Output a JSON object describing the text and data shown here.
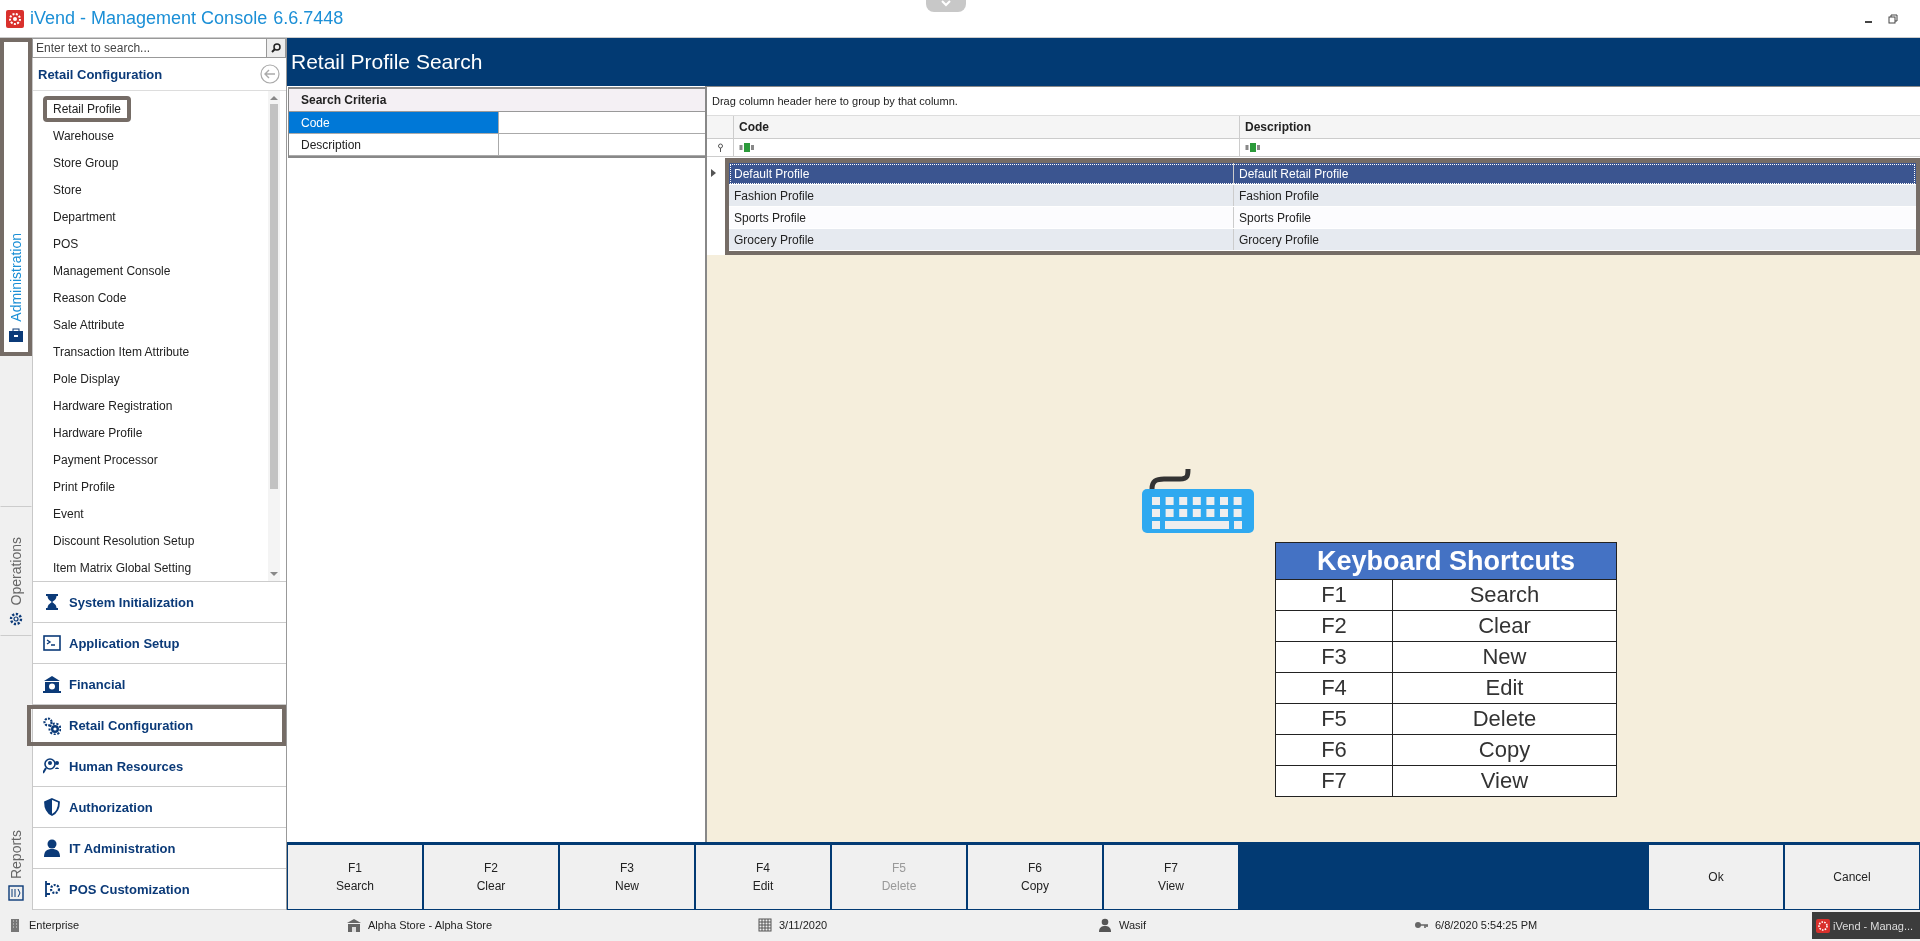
{
  "window": {
    "title": "iVend - Management Console",
    "version": "6.6.7448"
  },
  "side_tabs": [
    {
      "label": "Administration",
      "selected": true
    },
    {
      "label": "Operations",
      "selected": false
    },
    {
      "label": "Reports",
      "selected": false
    }
  ],
  "sidebar": {
    "search": {
      "placeholder": "Enter text to search..."
    },
    "title": "Retail Configuration",
    "items": [
      {
        "label": "Retail Profile",
        "selected": true
      },
      {
        "label": "Warehouse",
        "selected": false
      },
      {
        "label": "Store Group",
        "selected": false
      },
      {
        "label": "Store",
        "selected": false
      },
      {
        "label": "Department",
        "selected": false
      },
      {
        "label": "POS",
        "selected": false
      },
      {
        "label": "Management Console",
        "selected": false
      },
      {
        "label": "Reason Code",
        "selected": false
      },
      {
        "label": "Sale Attribute",
        "selected": false
      },
      {
        "label": "Transaction Item Attribute",
        "selected": false
      },
      {
        "label": "Pole Display",
        "selected": false
      },
      {
        "label": "Hardware Registration",
        "selected": false
      },
      {
        "label": "Hardware Profile",
        "selected": false
      },
      {
        "label": "Payment Processor",
        "selected": false
      },
      {
        "label": "Print Profile",
        "selected": false
      },
      {
        "label": "Event",
        "selected": false
      },
      {
        "label": "Discount Resolution Setup",
        "selected": false
      },
      {
        "label": "Item Matrix Global Setting",
        "selected": false
      }
    ],
    "sections": [
      {
        "label": "System Initialization",
        "kind": "hourglass",
        "selected": false
      },
      {
        "label": "Application Setup",
        "kind": "terminal",
        "selected": false
      },
      {
        "label": "Financial",
        "kind": "bank",
        "selected": false
      },
      {
        "label": "Retail Configuration",
        "kind": "gears",
        "selected": true
      },
      {
        "label": "Human Resources",
        "kind": "people",
        "selected": false
      },
      {
        "label": "Authorization",
        "kind": "shield",
        "selected": false
      },
      {
        "label": "IT Administration",
        "kind": "person",
        "selected": false
      },
      {
        "label": "POS Customization",
        "kind": "tools",
        "selected": false
      }
    ]
  },
  "page": {
    "title": "Retail Profile Search"
  },
  "search_criteria": {
    "title": "Search Criteria",
    "fields": [
      {
        "label": "Code",
        "selected": true
      },
      {
        "label": "Description",
        "selected": false
      }
    ]
  },
  "grid": {
    "group_hint": "Drag column header here to group by that column.",
    "columns": [
      "Code",
      "Description"
    ],
    "rows": [
      {
        "cells": [
          "Default Profile",
          "Default Retail Profile"
        ],
        "selected": true
      },
      {
        "cells": [
          "Fashion Profile",
          "Fashion Profile"
        ],
        "selected": false
      },
      {
        "cells": [
          "Sports Profile",
          "Sports Profile"
        ],
        "selected": false
      },
      {
        "cells": [
          "Grocery Profile",
          "Grocery Profile"
        ],
        "selected": false
      }
    ]
  },
  "shortcuts": {
    "title": "Keyboard Shortcuts",
    "rows": [
      {
        "key": "F1",
        "action": "Search"
      },
      {
        "key": "F2",
        "action": "Clear"
      },
      {
        "key": "F3",
        "action": "New"
      },
      {
        "key": "F4",
        "action": "Edit"
      },
      {
        "key": "F5",
        "action": "Delete"
      },
      {
        "key": "F6",
        "action": "Copy"
      },
      {
        "key": "F7",
        "action": "View"
      }
    ]
  },
  "toolbar": {
    "buttons": [
      {
        "key": "F1",
        "label": "Search",
        "disabled": false
      },
      {
        "key": "F2",
        "label": "Clear",
        "disabled": false
      },
      {
        "key": "F3",
        "label": "New",
        "disabled": false
      },
      {
        "key": "F4",
        "label": "Edit",
        "disabled": false
      },
      {
        "key": "F5",
        "label": "Delete",
        "disabled": true
      },
      {
        "key": "F6",
        "label": "Copy",
        "disabled": false
      },
      {
        "key": "F7",
        "label": "View",
        "disabled": false
      }
    ],
    "actions": [
      "Ok",
      "Cancel"
    ]
  },
  "status_bar": {
    "company": "Enterprise",
    "store": "Alpha Store - Alpha Store",
    "date": "3/11/2020",
    "user": "Wasif",
    "time": "6/8/2020 5:54:25 PM",
    "taskbar_item": "iVend - Manag..."
  }
}
